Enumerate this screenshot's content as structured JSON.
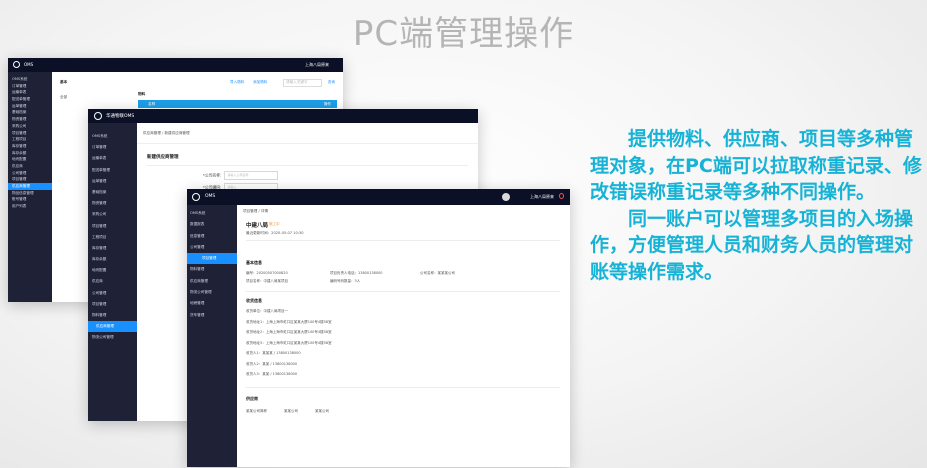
{
  "slide": {
    "title": "PC端管理操作",
    "paragraph1": "提供物料、供应商、项目等多种管理对象，在PC端可以拉取称重记录、修改错误称重记录等多种不同操作。",
    "paragraph2": "同一账户可以管理多项目的入场操作，方便管理人员和财务人员的管理对账等操作需求。"
  },
  "colors": {
    "accent_text": "#17b3d6",
    "title_gray": "#b5b5b5",
    "sidebar_dark": "#1f2236",
    "topbar_dark": "#0c1026",
    "highlight_blue": "#1890ff"
  },
  "window1": {
    "brand": "OMS",
    "user": "上海八局原来",
    "menu": [
      "OMS系统",
      "订单管理",
      "运输单表",
      "配送单管理",
      "运单管理",
      "基础档案",
      "物资管理",
      "采购公司",
      "项目管理",
      "工程项目",
      "库存管理",
      "库存余额",
      "地块配置",
      "供应商",
      "公司管理",
      "项目管理",
      "供应商管理",
      "物品信息管理",
      "账号管理",
      "用户列表"
    ],
    "menu_highlight_index": 16,
    "tree_header": "基本",
    "tree_items": [
      "全部"
    ],
    "toolbar_label": "物料",
    "toolbar_links": [
      "导入物料",
      "添加物料"
    ],
    "search_placeholder": "请输入关键字",
    "search_button": "查询",
    "table_header": "名称",
    "table_header_right": "操作"
  },
  "window2": {
    "brand": "华通物联OMS",
    "menu": [
      "OMS系统",
      "订单管理",
      "运输单表",
      "配送单管理",
      "运单管理",
      "基础档案",
      "物资管理",
      "采购公司",
      "项目管理",
      "工程项目",
      "库存管理",
      "库存余额",
      "地块配置",
      "供应商",
      "公司管理",
      "项目管理",
      "物料管理",
      "供应商管理",
      "物流公司管理"
    ],
    "menu_highlight_index": 17,
    "breadcrumb": "供应商管理  /  新建供应商管理",
    "page_title": "新建供应商管理",
    "form": [
      {
        "label": "*公司名称:",
        "placeholder": "请输入公司名称"
      },
      {
        "label": "*公司编码:",
        "placeholder": "请输入"
      }
    ]
  },
  "window3": {
    "brand": "OMS",
    "user": "上海八局原来",
    "menu": [
      "OMS系统",
      "数据报表",
      "信息管理",
      "公司管理",
      "项目管理",
      "物料管理",
      "供应商管理",
      "物流公司管理",
      "地磅管理",
      "货车管理"
    ],
    "menu_highlight_index": 4,
    "breadcrumb": "项目管理 / 详情",
    "record_title": "中建八局",
    "record_tag": "施工中",
    "record_subtitle": "最近更新时间：2020-05-07 10:30",
    "basic_section": "基本信息",
    "basic_lines": [
      [
        "编号：20200507000820",
        "项目负责人电话：13800138000",
        "公司名称：某某某公司"
      ],
      [
        "项目名称：中建八局某项目",
        "编码号码数量：3人"
      ]
    ],
    "receiver_section": "收货信息",
    "receiver_lines": [
      "收货单位：中建八局项目一",
      "收货地址1：上海上海市虹口区某某大厦100号4楼58室",
      "收货地址2：上海上海市虹口区某某大厦100号4楼58室",
      "收货地址3：上海上海市虹口区某某大厦100号4楼58室",
      "收货人1：某某某 / 13800138000",
      "收货人2：某某 / 13800138000",
      "收货人3：某某 / 13800138000"
    ],
    "supplier_section": "供应商",
    "supplier_items": [
      "某某公司简称",
      "某某公司",
      "某某公司"
    ]
  }
}
